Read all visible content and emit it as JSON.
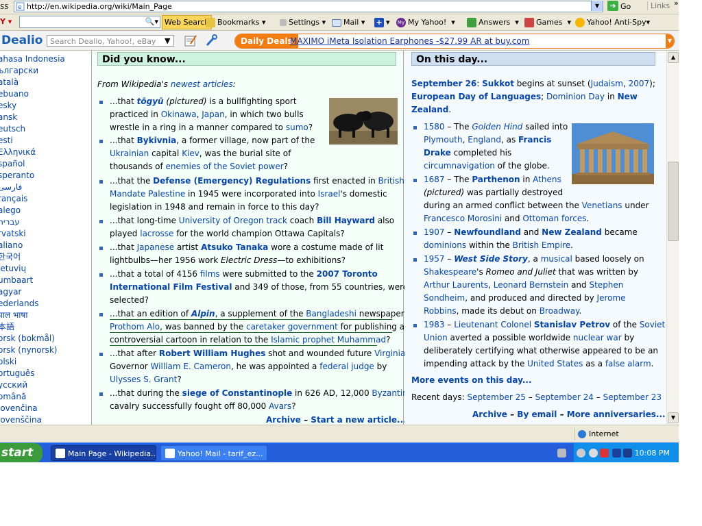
{
  "browser": {
    "address_label": "ss",
    "url": "http://en.wikipedia.org/wiki/Main_Page",
    "go_label": "Go",
    "links_label": "Links"
  },
  "yahoo_toolbar": {
    "web_search": "Web Search",
    "bookmarks": "Bookmarks",
    "settings": "Settings",
    "mail": "Mail",
    "my_yahoo": "My Yahoo!",
    "answers": "Answers",
    "games": "Games",
    "antispy": "Yahoo! Anti-Spy"
  },
  "dealio_toolbar": {
    "logo": "Dealio",
    "search_placeholder": "Search  Dealio, Yahoo!, eBay",
    "daily_deals": "Daily Deals",
    "ad_text": "MAXIMO iMeta Isolation Earphones -$27.99 AR at buy.com"
  },
  "languages": [
    "ahasa Indonesia",
    "ългарски",
    "atalà",
    "ebuano",
    "esky",
    "ansk",
    "eutsch",
    "esti",
    "Ελληνικά",
    "spañol",
    "speranto",
    "فارسی",
    "rançais",
    "alego",
    "עברית",
    "rvatski",
    "aliano",
    "한국어",
    "ietuvių",
    "umbaart",
    "agyar",
    "ederlands",
    "पाल भाषा",
    "本語",
    "orsk (bokmål)",
    "orsk (nynorsk)",
    "olski",
    "ortuguês",
    "усский",
    "omână",
    "lovenčina",
    "lovenščina"
  ],
  "dyk": {
    "heading": "Did you know...",
    "intro": [
      "From Wikipedia's ",
      "newest articles",
      ":"
    ],
    "archive": "Archive",
    "sep": " – ",
    "start_new": "Start a new article..."
  },
  "otd": {
    "heading": "On this day...",
    "date": "September 26",
    "more": "More events on this day...",
    "recent_label": "Recent days: ",
    "recent": [
      "September 25",
      "September 24",
      "September 23"
    ],
    "archive": "Archive",
    "by_email": "By email",
    "more_ann": "More anniversaries..."
  },
  "status": {
    "zone": "Internet"
  },
  "taskbar": {
    "start": "start",
    "task1": "Main Page - Wikipedia...",
    "task2": "Yahoo! Mail - tarif_ez...",
    "clock": "10:08 PM"
  }
}
